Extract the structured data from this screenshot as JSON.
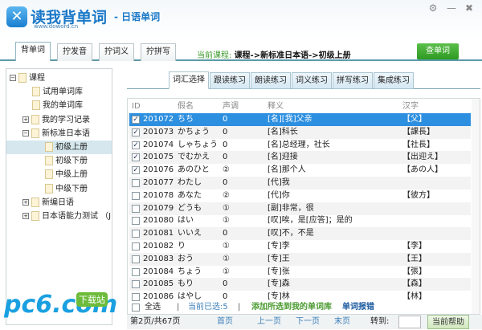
{
  "app": {
    "name": "读我背单词",
    "subtitle": "- 日语单词",
    "url": "www.doword.cn"
  },
  "window_controls": {
    "settings": "⚙",
    "minimize": "—",
    "close": "✖"
  },
  "top_tabs": [
    {
      "label": "背单词",
      "active": true
    },
    {
      "label": "拧发音"
    },
    {
      "label": "拧词义"
    },
    {
      "label": "拧拼写"
    }
  ],
  "current_course": {
    "label": "当前课程:",
    "value": "课程->新标准日本语->初级上册"
  },
  "lookup_button": "查单词",
  "tree": [
    {
      "label": "课程",
      "toggle": "−",
      "level": 0
    },
    {
      "label": "试用单词库",
      "level": 1,
      "leaf": true
    },
    {
      "label": "我的单词库",
      "level": 1,
      "leaf": true
    },
    {
      "label": "我的学习记录",
      "toggle": "+",
      "level": 1
    },
    {
      "label": "新标准日本语",
      "toggle": "−",
      "level": 1
    },
    {
      "label": "初级上册",
      "level": 2,
      "leaf": true,
      "selected": true
    },
    {
      "label": "初级下册",
      "level": 2,
      "leaf": true
    },
    {
      "label": "中级上册",
      "level": 2,
      "leaf": true
    },
    {
      "label": "中级下册",
      "level": 2,
      "leaf": true
    },
    {
      "label": "新编日语",
      "toggle": "+",
      "level": 1
    },
    {
      "label": "日本语能力测试 （JL",
      "toggle": "+",
      "level": 1
    }
  ],
  "sub_tabs": [
    {
      "label": "词汇选择",
      "active": true
    },
    {
      "label": "跟读练习"
    },
    {
      "label": "朗读练习"
    },
    {
      "label": "词义练习"
    },
    {
      "label": "拼写练习"
    },
    {
      "label": "集成练习"
    }
  ],
  "table": {
    "headers": {
      "id": "ID",
      "kana": "假名",
      "tone": "声调",
      "meaning": "释义",
      "kanji": "汉字"
    },
    "rows": [
      {
        "checked": true,
        "id": "201072",
        "kana": "ちち",
        "tone": "0",
        "meaning": "[名][我]父亲",
        "kanji": "【父】",
        "selected": true
      },
      {
        "checked": true,
        "id": "201073",
        "kana": "かちょう",
        "tone": "0",
        "meaning": "[名]科长",
        "kanji": "【課長】"
      },
      {
        "checked": true,
        "id": "201074",
        "kana": "しゃちょう",
        "tone": "0",
        "meaning": "[名]总经理，社长",
        "kanji": "【社長】"
      },
      {
        "checked": true,
        "id": "201075",
        "kana": "でむかえ",
        "tone": "0",
        "meaning": "[名]迎接",
        "kanji": "【出迎え】"
      },
      {
        "checked": true,
        "id": "201076",
        "kana": "あのひと",
        "tone": "②",
        "meaning": "[名]那个人",
        "kanji": "【あの人】"
      },
      {
        "checked": false,
        "id": "201077",
        "kana": "わたし",
        "tone": "0",
        "meaning": "[代]我",
        "kanji": ""
      },
      {
        "checked": false,
        "id": "201078",
        "kana": "あなた",
        "tone": "②",
        "meaning": "[代]你",
        "kanji": "【彼方】"
      },
      {
        "checked": false,
        "id": "201079",
        "kana": "どうも",
        "tone": "①",
        "meaning": "[副]非常，很",
        "kanji": ""
      },
      {
        "checked": false,
        "id": "201080",
        "kana": "はい",
        "tone": "①",
        "meaning": "[叹]唉，是[应答]；是的",
        "kanji": ""
      },
      {
        "checked": false,
        "id": "201081",
        "kana": "いいえ",
        "tone": "0",
        "meaning": "[叹]不，不是",
        "kanji": ""
      },
      {
        "checked": false,
        "id": "201082",
        "kana": "り",
        "tone": "①",
        "meaning": "[专]李",
        "kanji": "【李】"
      },
      {
        "checked": false,
        "id": "201083",
        "kana": "おう",
        "tone": "①",
        "meaning": "[专]王",
        "kanji": "【王】"
      },
      {
        "checked": false,
        "id": "201084",
        "kana": "ちょう",
        "tone": "①",
        "meaning": "[专]张",
        "kanji": "【張】"
      },
      {
        "checked": false,
        "id": "201085",
        "kana": "もり",
        "tone": "0",
        "meaning": "[专]森",
        "kanji": "【森】"
      },
      {
        "checked": false,
        "id": "201086",
        "kana": "はやし",
        "tone": "0",
        "meaning": "[专]林",
        "kanji": "【林】"
      }
    ]
  },
  "actions": {
    "select_all": "全选",
    "sep": "|",
    "selected_count": "当前已选:5",
    "add": "添加所选到我的单词库",
    "report": "单词报错"
  },
  "pager": {
    "page_info": "第2页/共67页",
    "first": "首页",
    "prev": "上一页",
    "next": "下一页",
    "last": "末页",
    "goto": "转到:",
    "goto_value": "",
    "help": "当前帮助"
  },
  "watermark": {
    "brand": "pc6.com",
    "badge": "下载站"
  },
  "colors": {
    "accent": "#2d8fe0",
    "green": "#3c9a2c"
  }
}
